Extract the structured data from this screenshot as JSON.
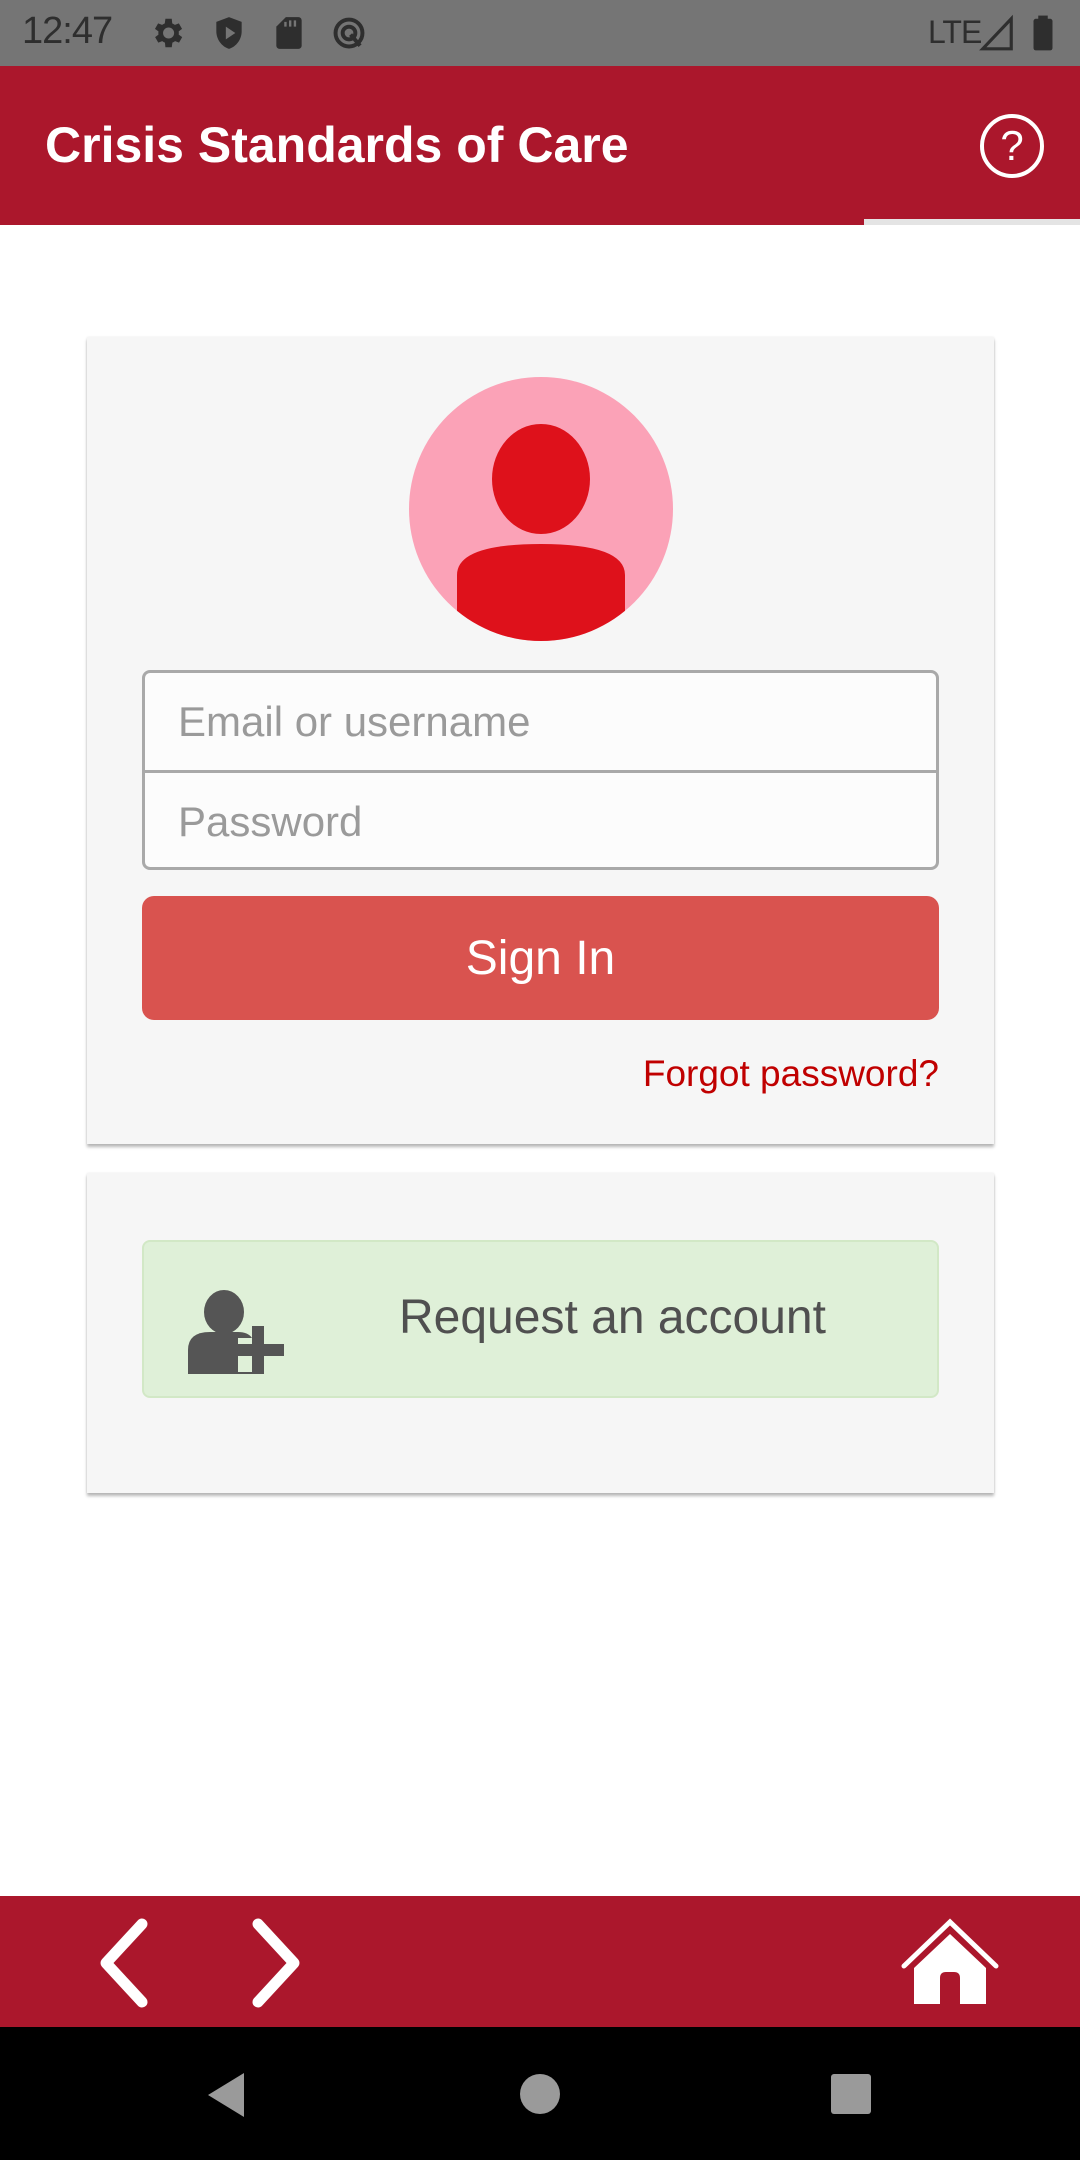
{
  "status_bar": {
    "time": "12:47",
    "network": "LTE",
    "icons": [
      "settings-icon",
      "shield-play-icon",
      "sd-card-icon",
      "data-saver-icon",
      "signal-icon",
      "battery-icon"
    ]
  },
  "header": {
    "title": "Crisis Standards of Care",
    "help_icon": "help-circle-icon"
  },
  "login_card": {
    "avatar_icon": "user-avatar-icon",
    "email_placeholder": "Email or username",
    "email_value": "",
    "password_placeholder": "Password",
    "password_value": "",
    "sign_in_label": "Sign In",
    "forgot_password_label": "Forgot password?"
  },
  "request_card": {
    "request_label": "Request an account",
    "request_icon": "user-plus-icon"
  },
  "bottom_bar": {
    "back_icon": "chevron-left-icon",
    "forward_icon": "chevron-right-icon",
    "home_icon": "home-icon"
  },
  "android_nav": {
    "back": "nav-back-icon",
    "home": "nav-home-icon",
    "recents": "nav-recents-icon"
  },
  "colors": {
    "brand": "#ab172c",
    "sign_in": "#d9534f",
    "link": "#c00000",
    "request_bg": "#dff0d8",
    "avatar_bg": "#fba2b7",
    "avatar_fg": "#de111b"
  }
}
